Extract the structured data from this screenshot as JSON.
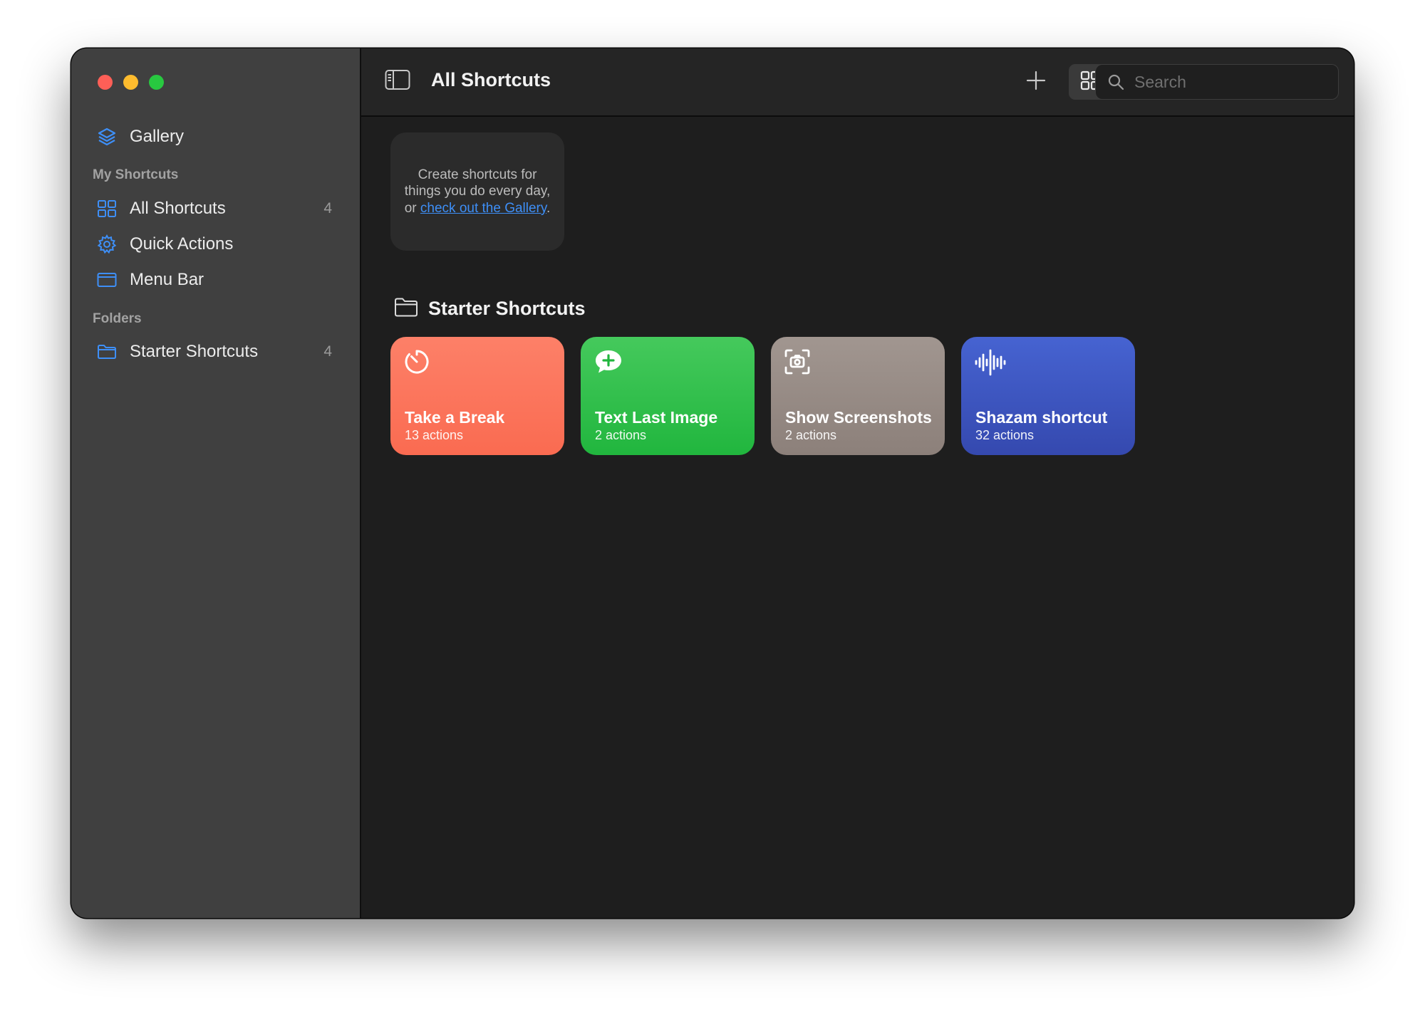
{
  "sidebar": {
    "gallery_label": "Gallery",
    "my_shortcuts_header": "My Shortcuts",
    "items": [
      {
        "label": "All Shortcuts",
        "count": "4"
      },
      {
        "label": "Quick Actions",
        "count": ""
      },
      {
        "label": "Menu Bar",
        "count": ""
      }
    ],
    "folders_header": "Folders",
    "folders": [
      {
        "label": "Starter Shortcuts",
        "count": "4"
      }
    ]
  },
  "toolbar": {
    "title": "All Shortcuts",
    "search_placeholder": "Search"
  },
  "create_card": {
    "text": "Create shortcuts for things you do every day, or ",
    "link": "check out the Gallery",
    "suffix": "."
  },
  "folder_section": {
    "title": "Starter Shortcuts"
  },
  "shortcuts": [
    {
      "name": "Take a Break",
      "actions": "13 actions",
      "icon": "timer-icon",
      "color": "#fa6b51"
    },
    {
      "name": "Text Last Image",
      "actions": "2 actions",
      "icon": "message-plus-icon",
      "color": "#21b63e"
    },
    {
      "name": "Show Screenshots",
      "actions": "2 actions",
      "icon": "screenshot-icon",
      "color": "#8c807a"
    },
    {
      "name": "Shazam shortcut",
      "actions": "32 actions",
      "icon": "waveform-icon",
      "color": "#3549af"
    }
  ],
  "colors": {
    "accent": "#3e8ff7",
    "sidebar_bg": "#404040",
    "main_bg": "#1e1e1e"
  }
}
